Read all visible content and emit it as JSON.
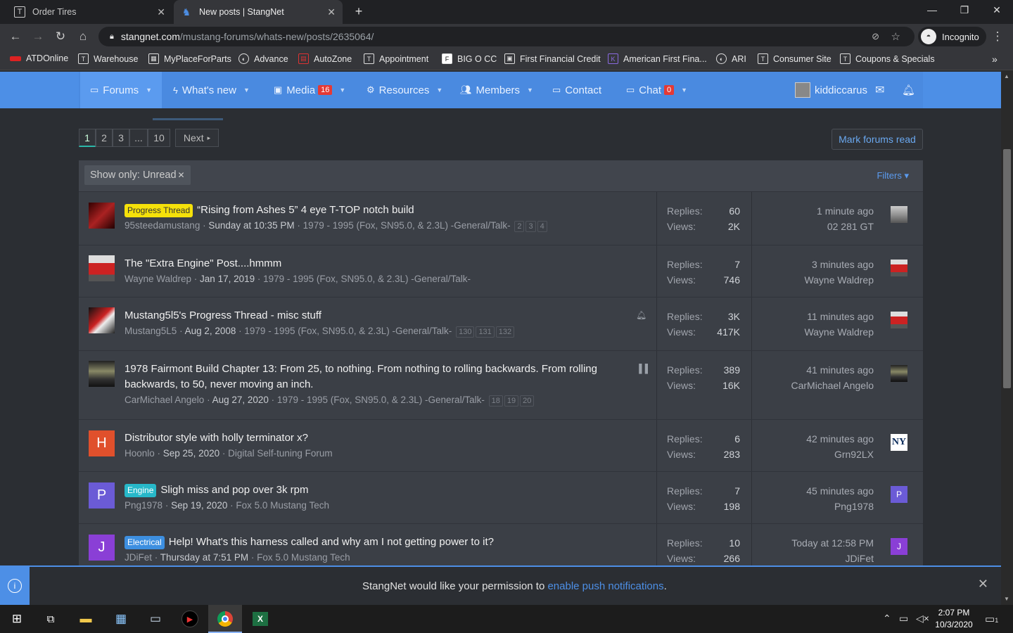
{
  "browser": {
    "tabs": [
      {
        "title": "Order Tires",
        "active": false
      },
      {
        "title": "New posts | StangNet",
        "active": true
      }
    ],
    "new_tab": "+",
    "window_controls": {
      "minimize": "—",
      "maximize": "❐",
      "close": "✕"
    },
    "url_host": "stangnet.com",
    "url_path": "/mustang-forums/whats-new/posts/2635064/",
    "profile": "Incognito",
    "bookmarks": [
      "ATDOnline",
      "Warehouse",
      "MyPlaceForParts",
      "Advance",
      "AutoZone",
      "Appointment",
      "BIG O CC",
      "First Financial Credit",
      "American First Fina...",
      "ARI",
      "Consumer Site",
      "Coupons & Specials"
    ],
    "bookmarks_more": "»"
  },
  "site": {
    "nav": [
      {
        "label": "Forums",
        "icon": "forums-icon"
      },
      {
        "label": "What's new",
        "icon": "bolt-icon"
      },
      {
        "label": "Media",
        "icon": "image-icon",
        "count": "16"
      },
      {
        "label": "Resources",
        "icon": "cogs-icon"
      },
      {
        "label": "Members",
        "icon": "users-icon"
      },
      {
        "label": "Contact",
        "icon": "folder-icon"
      },
      {
        "label": "Chat",
        "icon": "chat-icon",
        "count": "0"
      }
    ],
    "username": "kiddiccarus",
    "accent": "#4d8fe6"
  },
  "pagination": {
    "pages": [
      "1",
      "2",
      "3",
      "...",
      "10"
    ],
    "current": "1",
    "next": "Next"
  },
  "mark_read": "Mark forums read",
  "filter": {
    "show_only": "Show only: Unread",
    "filters_label": "Filters"
  },
  "labels": {
    "replies": "Replies:",
    "views": "Views:"
  },
  "threads": [
    {
      "prefix": "Progress Thread",
      "title": "“Rising from Ashes 5” 4 eye T-TOP notch build",
      "author": "95steedamustang",
      "date": "Sunday at 10:35 PM",
      "forum": "1979 - 1995 (Fox, SN95.0, & 2.3L) -General/Talk-",
      "pages": [
        "2",
        "3",
        "4"
      ],
      "replies": "60",
      "views": "2K",
      "last_time": "1 minute ago",
      "last_user": "02 281 GT"
    },
    {
      "prefix": "",
      "title": "The \"Extra Engine\" Post....hmmm",
      "author": "Wayne Waldrep",
      "date": "Jan 17, 2019",
      "forum": "1979 - 1995 (Fox, SN95.0, & 2.3L) -General/Talk-",
      "pages": [],
      "replies": "7",
      "views": "746",
      "last_time": "3 minutes ago",
      "last_user": "Wayne Waldrep"
    },
    {
      "prefix": "",
      "title": "Mustang5l5's Progress Thread - misc stuff",
      "author": "Mustang5L5",
      "date": "Aug 2, 2008",
      "forum": "1979 - 1995 (Fox, SN95.0, & 2.3L) -General/Talk-",
      "pages": [
        "130",
        "131",
        "132"
      ],
      "replies": "3K",
      "views": "417K",
      "last_time": "11 minutes ago",
      "last_user": "Wayne Waldrep"
    },
    {
      "prefix": "",
      "title": "1978 Fairmont Build Chapter 13: From 25, to nothing. From nothing to rolling backwards. From rolling backwards, to 50, never moving an inch.",
      "author": "CarMichael Angelo",
      "date": "Aug 27, 2020",
      "forum": "1979 - 1995 (Fox, SN95.0, & 2.3L) -General/Talk-",
      "pages": [
        "18",
        "19",
        "20"
      ],
      "replies": "389",
      "views": "16K",
      "last_time": "41 minutes ago",
      "last_user": "CarMichael Angelo"
    },
    {
      "prefix": "",
      "title": "Distributor style with holly terminator x?",
      "author": "Hoonlo",
      "date": "Sep 25, 2020",
      "forum": "Digital Self-tuning Forum",
      "pages": [],
      "replies": "6",
      "views": "283",
      "last_time": "42 minutes ago",
      "last_user": "Grn92LX",
      "avatar_letter": "H",
      "avatar_color": "#e0502c"
    },
    {
      "prefix": "Engine",
      "title": "Sligh miss and pop over 3k rpm",
      "author": "Png1978",
      "date": "Sep 19, 2020",
      "forum": "Fox 5.0 Mustang Tech",
      "pages": [],
      "replies": "7",
      "views": "198",
      "last_time": "45 minutes ago",
      "last_user": "Png1978",
      "avatar_letter": "P",
      "avatar_color": "#6b5bd6",
      "last_avatar_letter": "P"
    },
    {
      "prefix": "Electrical",
      "title": "Help! What's this harness called and why am I not getting power to it?",
      "author": "JDiFet",
      "date": "Thursday at 7:51 PM",
      "forum": "Fox 5.0 Mustang Tech",
      "pages": [],
      "replies": "10",
      "views": "266",
      "last_time": "Today at 12:58 PM",
      "last_user": "JDiFet",
      "avatar_letter": "J",
      "avatar_color": "#8a3fd6",
      "last_avatar_letter": "J"
    }
  ],
  "notice": {
    "text": "StangNet would like your permission to ",
    "link": "enable push notifications",
    "end": "."
  },
  "taskbar": {
    "time": "2:07 PM",
    "date": "10/3/2020",
    "notif_count": "1"
  }
}
